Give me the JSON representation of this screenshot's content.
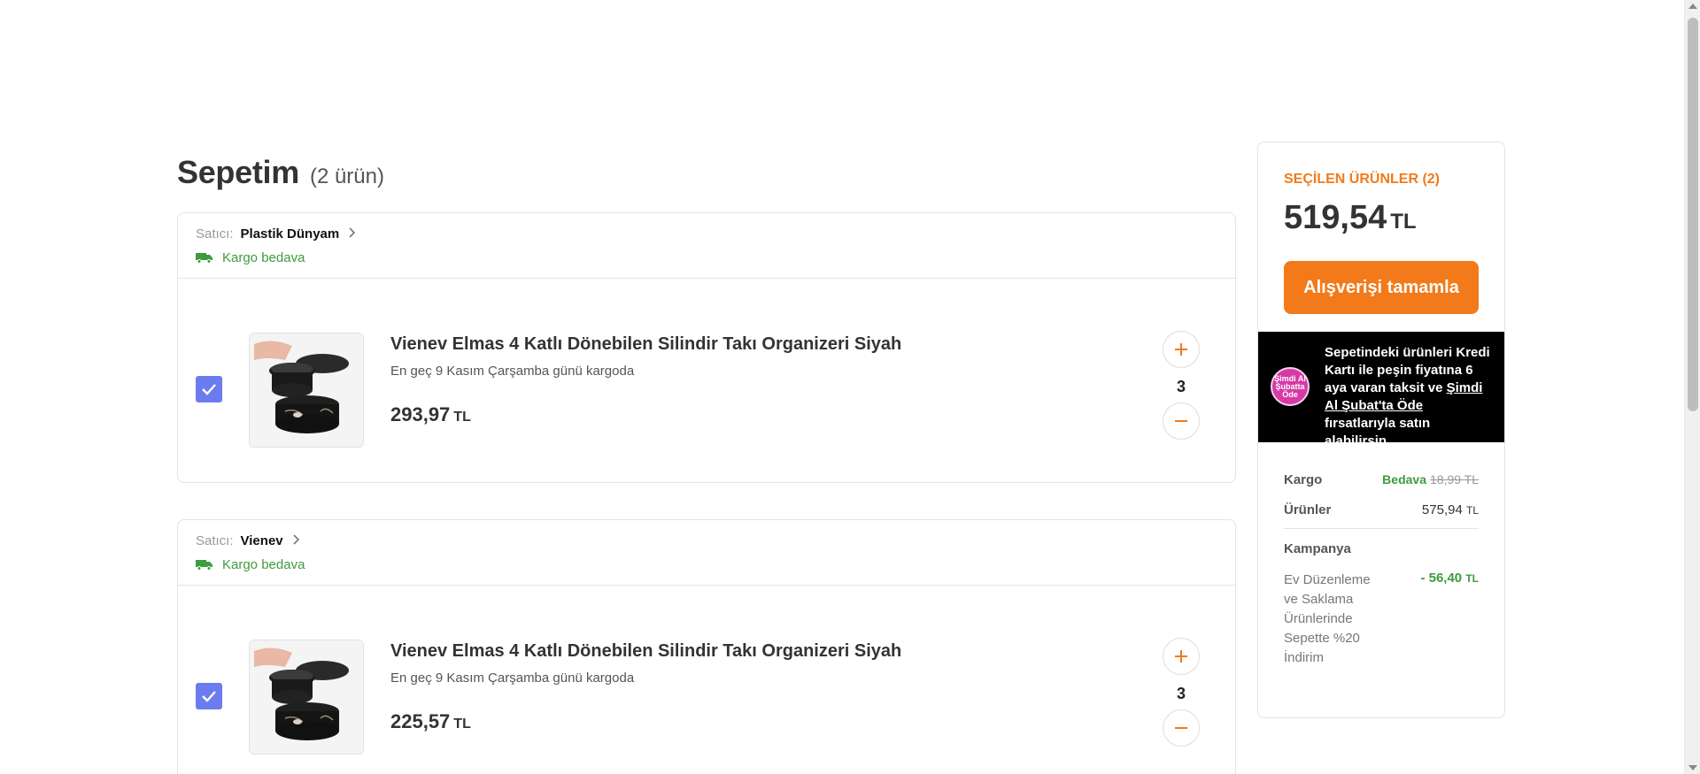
{
  "cart": {
    "title": "Sepetim",
    "count_label": "(2 ürün)"
  },
  "sellers": [
    {
      "seller_label": "Satıcı:",
      "seller_name": "Plastik Dünyam",
      "shipping_text": "Kargo bedava",
      "item": {
        "checked": true,
        "title": "Vienev Elmas 4 Katlı Dönebilen Silindir Takı Organizeri Siyah",
        "delivery": "En geç 9 Kasım Çarşamba günü kargoda",
        "price": "293,97",
        "currency": "TL",
        "quantity": "3"
      }
    },
    {
      "seller_label": "Satıcı:",
      "seller_name": "Vienev",
      "shipping_text": "Kargo bedava",
      "item": {
        "checked": true,
        "title": "Vienev Elmas 4 Katlı Dönebilen Silindir Takı Organizeri Siyah",
        "delivery": "En geç 9 Kasım Çarşamba günü kargoda",
        "price": "225,57",
        "currency": "TL",
        "quantity": "3"
      }
    }
  ],
  "summary": {
    "selected_label": "SEÇİLEN ÜRÜNLER (2)",
    "total": "519,54",
    "currency": "TL",
    "checkout_label": "Alışverişi tamamla",
    "promo": {
      "logo_text_1": "Şimdi Al",
      "logo_text_2": "Şubatta",
      "logo_text_3": "Öde",
      "t1": "Sepetindeki ürünleri ",
      "t2": "Kredi Kartı ile peşin fiyatına 6 aya varan taksit",
      "t3": " ve ",
      "t4": "Şimdi Al Şubat'ta Öde",
      "t5": " fırsatlarıyla satın alabilirsin."
    },
    "kargo_label": "Kargo",
    "kargo_free": "Bedava",
    "kargo_old": "18,99 TL",
    "products_label": "Ürünler",
    "products_value": "575,94",
    "campaign_label": "Kampanya",
    "campaign_desc": "Ev Düzenleme ve Saklama Ürünlerinde Sepette %20 İndirim",
    "campaign_amount": "- 56,40",
    "currency_small": "TL"
  },
  "colors": {
    "accent": "#f27a1a",
    "success": "#3e9b3e",
    "checkbox": "#6b7cf0"
  },
  "icons": {
    "seller_chevron": "chevron-right-icon",
    "truck": "truck-icon",
    "check": "check-icon",
    "plus": "plus-icon",
    "minus": "minus-icon"
  }
}
